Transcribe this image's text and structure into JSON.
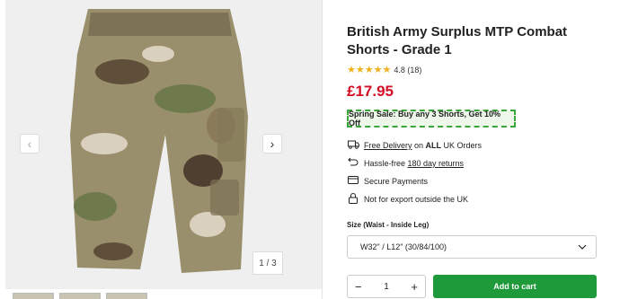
{
  "gallery": {
    "prev_icon": "‹",
    "next_icon": "›",
    "counter": "1 / 3",
    "thumb_count": 3
  },
  "product": {
    "title": "British Army Surplus MTP Combat Shorts - Grade 1",
    "stars": "★★★★★",
    "rating": "4.8 (18)",
    "price": "£17.95",
    "promo": "Spring Sale: Buy any 3 Shorts, Get 10% Off"
  },
  "features": {
    "delivery_link": "Free Delivery",
    "delivery_mid": " on ",
    "delivery_bold": "ALL",
    "delivery_end": " UK Orders",
    "returns_text": "Hassle-free ",
    "returns_link": "180 day returns",
    "payments": "Secure Payments",
    "export": "Not for export outside the UK"
  },
  "options": {
    "size_label": "Size (Waist - Inside Leg)",
    "size_value": "W32\" / L12\" (30/84/100)",
    "chevron": "⌄"
  },
  "purchase": {
    "minus": "−",
    "quantity": "1",
    "plus": "+",
    "add_to_cart": "Add to cart"
  },
  "colors": {
    "price": "#d40f24",
    "promo_border": "#3aa539",
    "cart_button": "#1e9a3b",
    "stars": "#f2b01e"
  }
}
